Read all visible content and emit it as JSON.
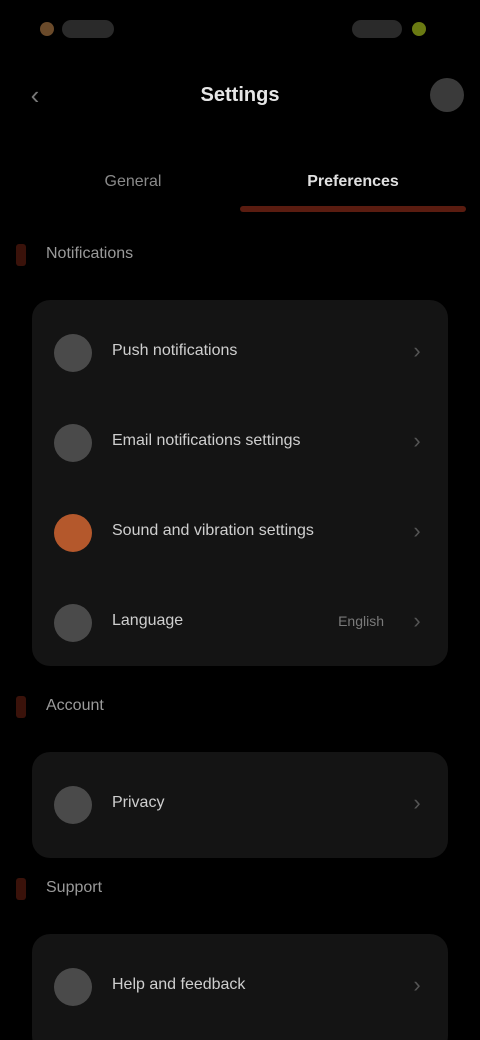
{
  "header": {
    "title": "Settings",
    "back_icon": "chevron-left-icon",
    "action_icon": "avatar-icon"
  },
  "tabs": [
    {
      "label": "General"
    },
    {
      "label": "Preferences"
    }
  ],
  "sections": [
    {
      "label": "Notifications",
      "rows": [
        {
          "label": "Push notifications",
          "value": "",
          "icon": "bell-icon"
        },
        {
          "label": "Email notifications settings",
          "value": "",
          "icon": "mail-icon"
        },
        {
          "label": "Sound and vibration settings",
          "value": "",
          "icon": "sound-icon"
        },
        {
          "label": "Language",
          "value": "English",
          "icon": "globe-icon"
        }
      ]
    },
    {
      "label": "Account",
      "rows": [
        {
          "label": "Privacy",
          "value": "",
          "icon": "lock-icon"
        }
      ]
    },
    {
      "label": "Support",
      "rows": [
        {
          "label": "Help and feedback",
          "value": "",
          "icon": "help-icon"
        }
      ]
    }
  ],
  "colors": {
    "accent": "#b4582c",
    "tab_indicator": "#5a1c10",
    "status_green": "#7f8f10",
    "status_orange": "#8a5a2a"
  }
}
